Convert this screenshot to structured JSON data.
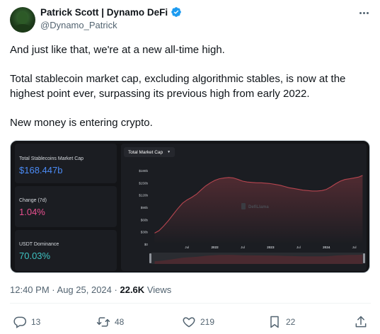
{
  "author": {
    "display_name": "Patrick Scott | Dynamo DeFi",
    "handle": "@Dynamo_Patrick"
  },
  "tweet": {
    "paragraphs": [
      "And just like that, we're at a new all-time high.",
      "Total stablecoin market cap, excluding algorithmic stables, is now at the highest point ever, surpassing its previous high from early 2022.",
      "New money is entering crypto."
    ]
  },
  "media": {
    "stats": [
      {
        "label": "Total Stablecoins Market Cap",
        "value": "$168.447b"
      },
      {
        "label": "Change (7d)",
        "value": "1.04%"
      },
      {
        "label": "USDT Dominance",
        "value": "70.03%"
      }
    ],
    "chart_tab": "Total Market Cap",
    "watermark": "DefiLlama",
    "accent_colors": {
      "market_cap": "#4b8bf5",
      "change": "#e8508f",
      "dominance": "#3ec3c3",
      "line": "#b5454f"
    }
  },
  "chart_data": {
    "type": "area",
    "title": "Total Market Cap",
    "xlabel": "",
    "ylabel": "",
    "y_ticks": [
      "$0",
      "$30b",
      "$60b",
      "$90b",
      "$120b",
      "$150b",
      "$180b"
    ],
    "ylim": [
      0,
      180
    ],
    "x_ticks": [
      "Jul",
      "2022",
      "Jul",
      "2023",
      "Jul",
      "2024",
      "Jul"
    ],
    "x_tick_positions": [
      2021.5,
      2022.0,
      2022.5,
      2023.0,
      2023.5,
      2024.0,
      2024.5
    ],
    "xlim": [
      2020.85,
      2024.67
    ],
    "grid": false,
    "series": [
      {
        "x": [
          2020.92,
          2021.0,
          2021.08,
          2021.17,
          2021.25,
          2021.33,
          2021.42,
          2021.5,
          2021.58,
          2021.67,
          2021.75,
          2021.83,
          2021.92,
          2022.0,
          2022.08,
          2022.17,
          2022.25,
          2022.33,
          2022.42,
          2022.5,
          2022.58,
          2022.67,
          2022.75,
          2022.83,
          2022.92,
          2023.0,
          2023.08,
          2023.17,
          2023.25,
          2023.33,
          2023.42,
          2023.5,
          2023.58,
          2023.67,
          2023.75,
          2023.83,
          2023.92,
          2024.0,
          2024.08,
          2024.17,
          2024.25,
          2024.33,
          2024.42,
          2024.5,
          2024.58,
          2024.65
        ],
        "values": [
          27,
          33,
          44,
          58,
          72,
          86,
          100,
          108,
          114,
          122,
          132,
          142,
          150,
          156,
          160,
          162,
          163,
          162,
          158,
          154,
          152,
          151,
          150,
          150,
          149,
          148,
          146,
          144,
          141,
          138,
          136,
          134,
          132,
          131,
          130,
          130,
          131,
          134,
          140,
          148,
          154,
          158,
          160,
          162,
          164,
          168
        ]
      }
    ]
  },
  "footer": {
    "time": "12:40 PM",
    "separator": "·",
    "date": "Aug 25, 2024",
    "views_count": "22.6K",
    "views_label": "Views"
  },
  "actions": {
    "replies": "13",
    "reposts": "48",
    "likes": "219",
    "bookmarks": "22"
  }
}
